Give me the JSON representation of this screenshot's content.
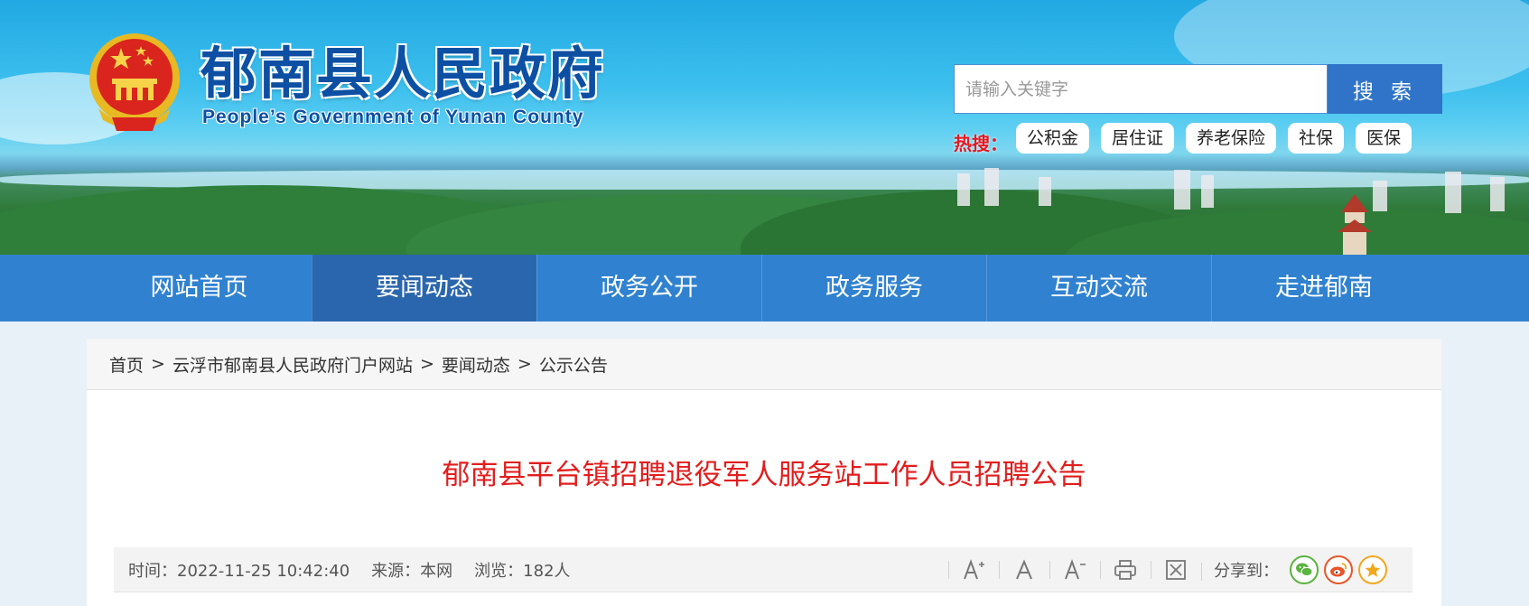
{
  "header": {
    "site_title": "郁南县人民政府",
    "site_subtitle": "People’s Government of Yunan County",
    "search": {
      "placeholder": "请输入关键字",
      "button_label": "搜 索"
    },
    "hot_search": {
      "label": "热搜：",
      "tags": [
        "公积金",
        "居住证",
        "养老保险",
        "社保",
        "医保"
      ]
    }
  },
  "nav": {
    "items": [
      "网站首页",
      "要闻动态",
      "政务公开",
      "政务服务",
      "互动交流",
      "走进郁南"
    ],
    "active": "要闻动态"
  },
  "breadcrumb": [
    "首页",
    "云浮市郁南县人民政府门户网站",
    "要闻动态",
    "公示公告"
  ],
  "breadcrumb_separator": ">",
  "article": {
    "title": "郁南县平台镇招聘退役军人服务站工作人员招聘公告",
    "meta": {
      "time": "时间：2022-11-25 10:42:40",
      "source": "来源：本网",
      "views": "浏览：182人"
    },
    "tools": [
      "font-increase-icon",
      "font-normal-icon",
      "font-decrease-icon",
      "print-icon",
      "close-window-icon"
    ],
    "share_label": "分享到：",
    "share_targets": [
      {
        "icon": "wechat-icon",
        "color": "#5bb342"
      },
      {
        "icon": "weibo-icon",
        "color": "#e8562a"
      },
      {
        "icon": "favorite-icon",
        "color": "#f0a91d"
      }
    ]
  },
  "colors": {
    "nav_bg": "#3082d0",
    "nav_active": "#2a66ad",
    "title_red": "#e21d1d",
    "hot_label": "#e8171f",
    "brand_blue": "#0d4fa3"
  }
}
